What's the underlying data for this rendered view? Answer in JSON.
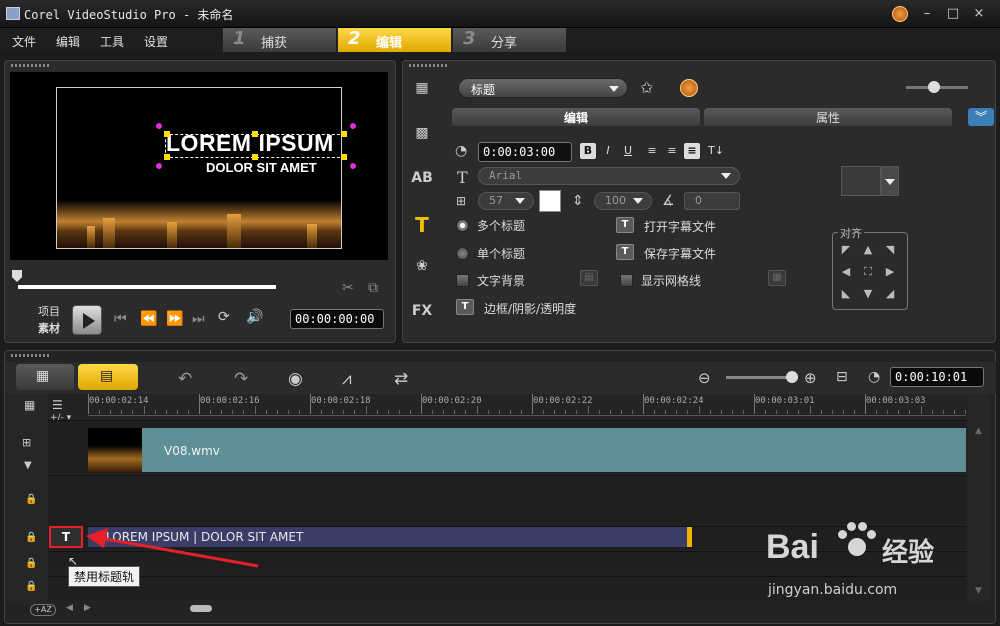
{
  "window": {
    "title": "Corel VideoStudio Pro - 未命名",
    "minimize": "–",
    "maximize": "□",
    "close": "×"
  },
  "menu": [
    "文件",
    "编辑",
    "工具",
    "设置"
  ],
  "steps": [
    {
      "num": "1",
      "label": "捕获"
    },
    {
      "num": "2",
      "label": "编辑"
    },
    {
      "num": "3",
      "label": "分享"
    }
  ],
  "preview": {
    "title_line1": "LOREM IPSUM",
    "title_line2": "DOLOR SIT AMET",
    "label_project": "项目",
    "label_clip": "素材",
    "timecode": "00:00:00:00"
  },
  "options": {
    "dropdown": "标题",
    "tab_edit": "编辑",
    "tab_attributes": "属性",
    "duration": "0:00:03:00",
    "format": {
      "bold": "B",
      "italic": "I",
      "underline": "U"
    },
    "font": "Arial",
    "font_size": "57",
    "line_spacing": "100",
    "angle": "0",
    "multi_title": "多个标题",
    "single_title": "单个标题",
    "open_subtitle": "打开字幕文件",
    "save_subtitle": "保存字幕文件",
    "text_background": "文字背景",
    "show_grid": "显示网格线",
    "border_shadow": "边框/阴影/透明度",
    "align_label": "对齐",
    "text_color": "#ffffff"
  },
  "timeline": {
    "zoom_time": "0:00:10:01",
    "ruler": [
      "00:00:02:14",
      "00:00:02:16",
      "00:00:02:18",
      "00:00:02:20",
      "00:00:02:22",
      "00:00:02:24",
      "00:00:03:01",
      "00:00:03:03"
    ],
    "video_clip": "V08.wmv",
    "title_clip": "LOREM IPSUM | DOLOR SIT AMET",
    "tooltip": "禁用标题轨",
    "add_remove": "+/- ▾",
    "view_toggle": "+AZ"
  },
  "watermark": {
    "brand": "Bai",
    "brand2": "经验",
    "url": "jingyan.baidu.com"
  },
  "colors": {
    "accent": "#f2c200",
    "video_clip": "#5e8f96",
    "title_clip": "#3b3d68",
    "highlight_red": "#e8202a"
  }
}
